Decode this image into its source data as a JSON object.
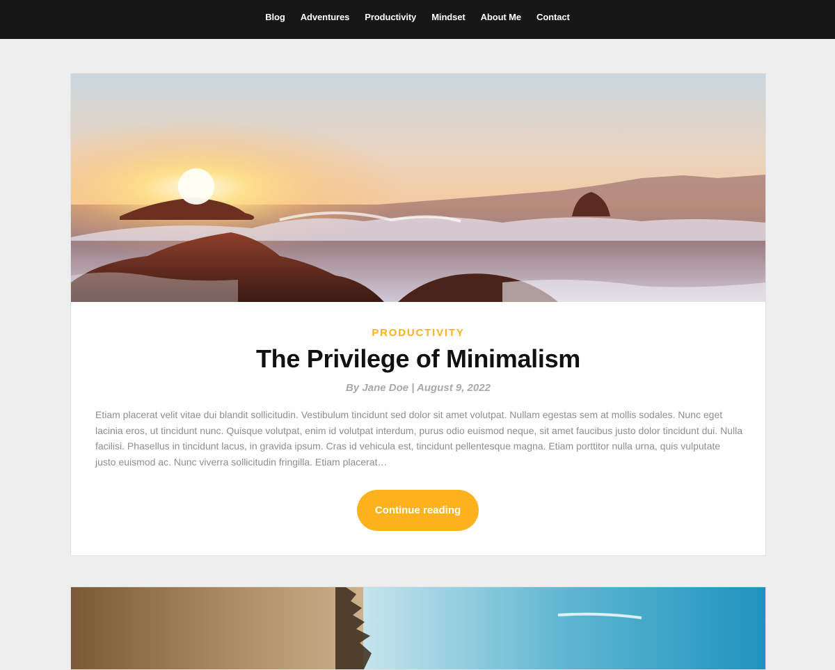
{
  "nav": {
    "items": [
      {
        "label": "Blog"
      },
      {
        "label": "Adventures"
      },
      {
        "label": "Productivity"
      },
      {
        "label": "Mindset"
      },
      {
        "label": "About Me"
      },
      {
        "label": "Contact"
      }
    ]
  },
  "post": {
    "category": "Productivity",
    "title": "The Privilege of Minimalism",
    "meta": "By Jane Doe | August 9, 2022",
    "excerpt": "Etiam placerat velit vitae dui blandit sollicitudin. Vestibulum tincidunt sed dolor sit amet volutpat. Nullam egestas sem at mollis sodales. Nunc eget lacinia eros, ut tincidunt nunc. Quisque volutpat, enim id volutpat interdum, purus odio euismod neque, sit amet faucibus justo dolor tincidunt dui. Nulla facilisi. Phasellus in tincidunt lacus, in gravida ipsum. Cras id vehicula est, tincidunt pellentesque magna. Etiam porttitor nulla urna, quis vulputate justo euismod ac. Nunc viverra sollicitudin fringilla. Etiam placerat…",
    "button_label": "Continue reading",
    "image": "sunset-ocean-waves-rocks-photo"
  },
  "next_post": {
    "image": "coastal-trees-blue-sea-photo"
  },
  "colors": {
    "accent": "#fbb21c",
    "nav_bg": "#171717",
    "page_bg": "#eeeeee"
  }
}
